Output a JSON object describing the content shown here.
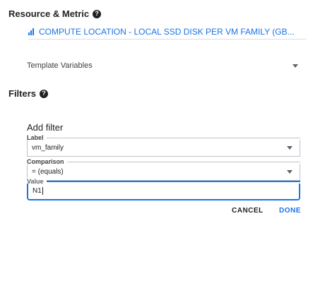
{
  "resource_metric": {
    "title": "Resource & Metric",
    "help_glyph": "?",
    "metric_label": "COMPUTE LOCATION - LOCAL SSD DISK PER VM FAMILY (GB..."
  },
  "template_variables": {
    "label": "Template Variables"
  },
  "filters": {
    "title": "Filters",
    "help_glyph": "?"
  },
  "add_filter": {
    "title": "Add filter",
    "label_field": {
      "legend": "Label",
      "value": "vm_family"
    },
    "comparison_field": {
      "legend": "Comparison",
      "value": "= (equals)"
    },
    "value_field": {
      "legend": "Value",
      "value": "N1"
    },
    "cancel_label": "CANCEL",
    "done_label": "DONE"
  },
  "colors": {
    "accent": "#1a73e8",
    "text": "#202124",
    "border": "#bdc1c6"
  }
}
